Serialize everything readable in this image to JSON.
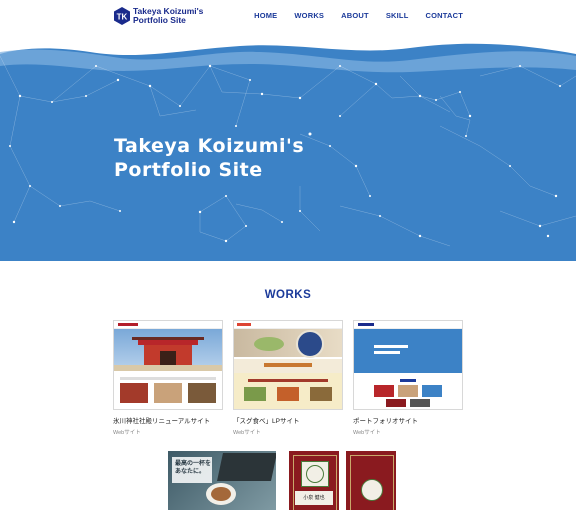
{
  "header": {
    "logo_line1": "Takeya Koizumi's",
    "logo_line2": "Portfolio Site",
    "nav": [
      "HOME",
      "WORKS",
      "ABOUT",
      "SKILL",
      "CONTACT"
    ]
  },
  "hero": {
    "title_line1": "Takeya Koizumi's",
    "title_line2": "Portfolio Site"
  },
  "works": {
    "title": "WORKS",
    "items": [
      {
        "title": "氷川神社社殿リニューアルサイト",
        "category": "Webサイト"
      },
      {
        "title": "「スグ食べ」LPサイト",
        "category": "Webサイト"
      },
      {
        "title": "ポートフォリオサイト",
        "category": "Webサイト"
      }
    ],
    "coffee_text_1": "最高の一杯を",
    "coffee_text_2": "あなたに。",
    "card_name": "小泉 健也"
  },
  "colors": {
    "brand": "#1b3a9a",
    "hero_blue": "#3c82c6",
    "maroon": "#8a1a1f"
  }
}
